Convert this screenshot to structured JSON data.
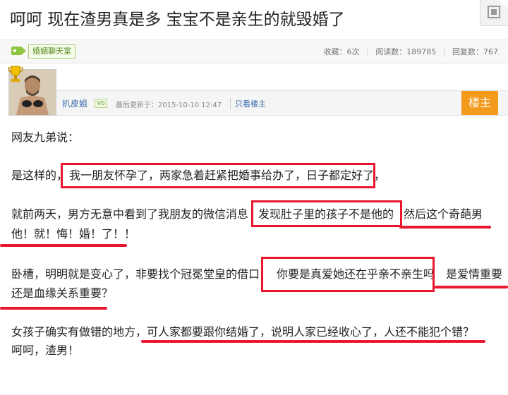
{
  "thread": {
    "title": "呵呵 现在渣男真是多 宝宝不是亲生的就毁婚了",
    "forum": "婚姻聊天室",
    "stats": {
      "favorites": "收藏：6次",
      "reads": "阅读数：189785",
      "replies": "回复数：767"
    }
  },
  "post": {
    "author": "扒皮姐",
    "level_badge": "V0",
    "updated": "最后更新于：2015-10-10 12:47",
    "only_op": "只看楼主",
    "owner_badge": "楼主",
    "lines": {
      "l1": "网友九弟说：",
      "l2a": "是这样的，",
      "l2b": "我一朋友怀孕了，两家急着赶紧把婚事给办了，日子都定好了",
      "l2c": "，",
      "l3a": "就前两天，男方无意中看到了我朋友的微信消息",
      "l3b": "发现肚子里的孩子不是他的",
      "l3c": "然后这个奇葩男",
      "l4": "他！就！悔！婚！了！！",
      "l5a": "卧槽，明明就是变心了，非要找个冠冕堂皇的借口！",
      "l5b": "你要是真爱她还在乎亲不亲生吗",
      "l5c": "是爱情重要",
      "l6": "还是血缘关系重要？",
      "l7a": "女孩子确实有做错的地方，",
      "l7b": "可人家都要跟你结婚了，说明人家已经收心了，人还不能犯个错？",
      "l8": "呵呵，渣男！"
    }
  },
  "colors": {
    "highlight": "#e8172f",
    "owner_badge": "#f39a1c",
    "forum_tag": "#8cc63f",
    "link": "#3366aa"
  },
  "icons": [
    "tag-icon",
    "qr-code-icon",
    "trophy-icon"
  ]
}
